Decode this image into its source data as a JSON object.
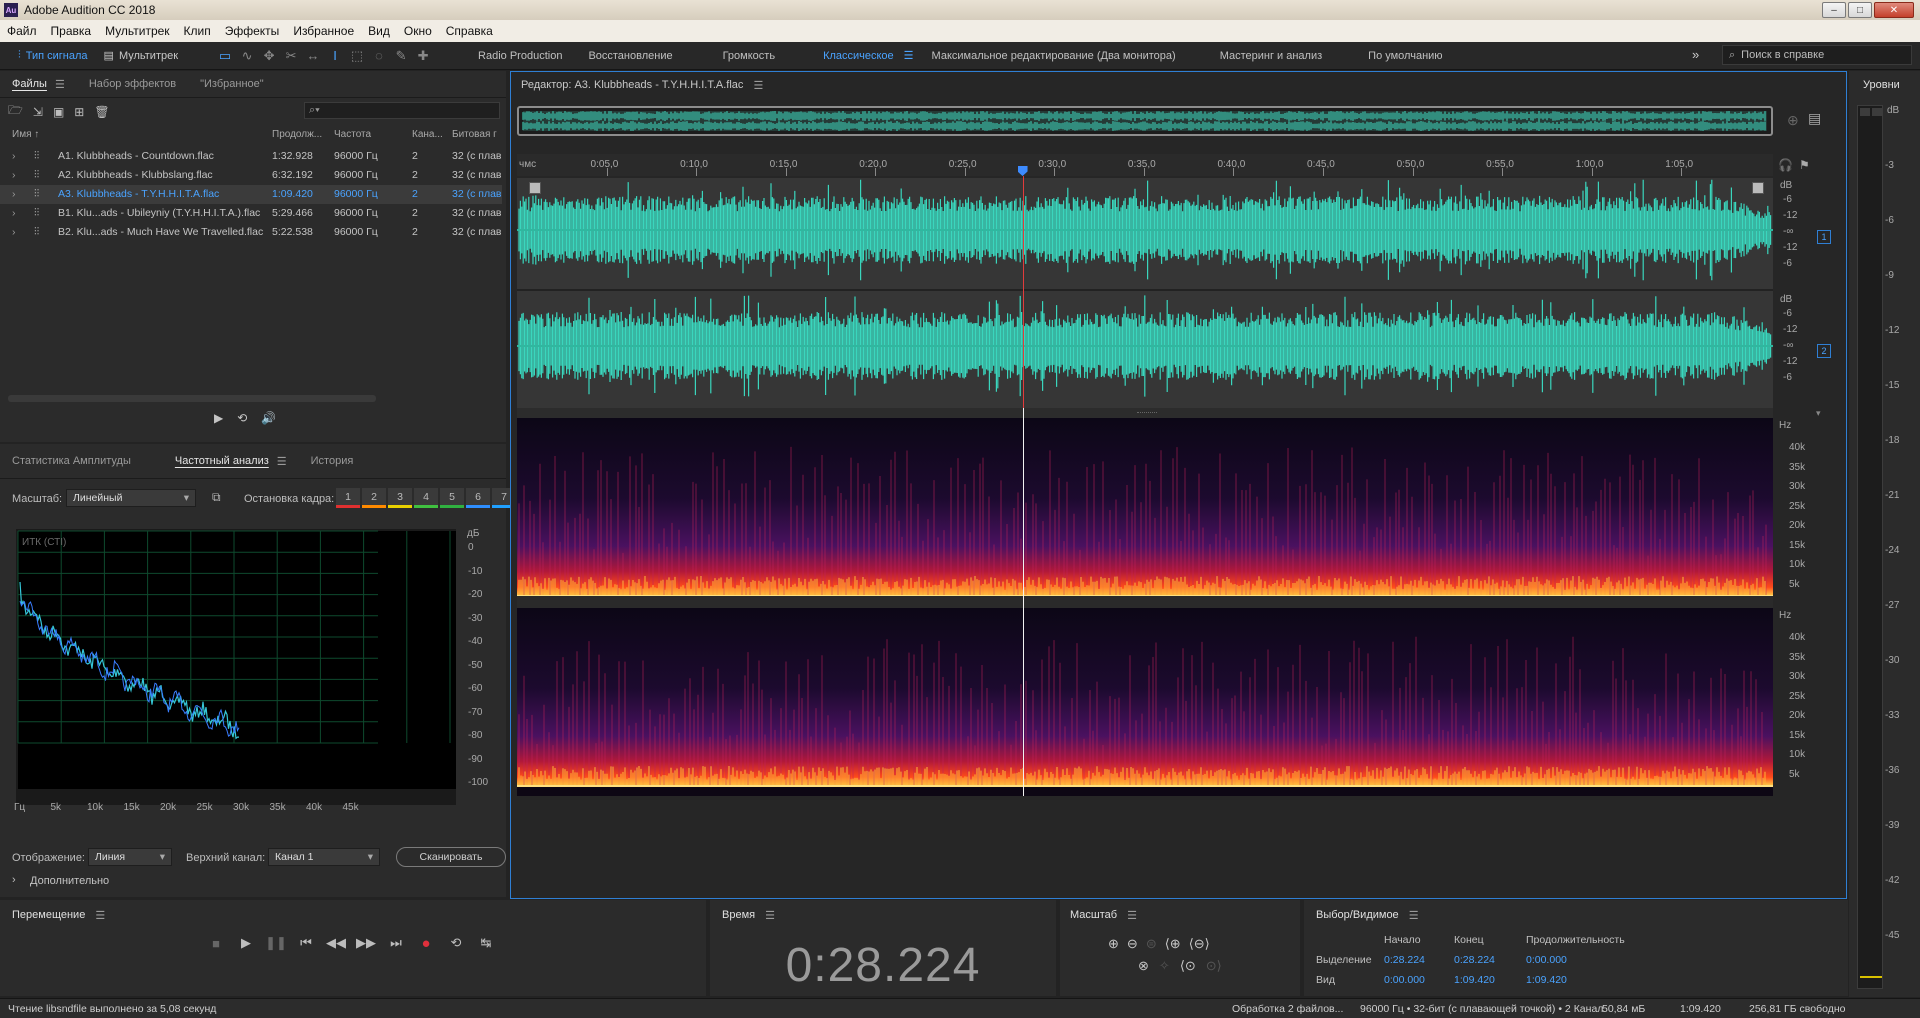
{
  "titlebar": {
    "app_title": "Adobe Audition CC 2018",
    "icon_text": "Au"
  },
  "menu": [
    "Файл",
    "Правка",
    "Мультитрек",
    "Клип",
    "Эффекты",
    "Избранное",
    "Вид",
    "Окно",
    "Справка"
  ],
  "toolbar": {
    "waveform_label": "Тип сигнала",
    "multitrack_label": "Мультитрек",
    "workspaces": [
      "Radio Production",
      "Восстановление",
      "Громкость",
      "Классическое",
      "Максимальное редактирование (Два монитора)",
      "Мастеринг и анализ",
      "По умолчанию"
    ],
    "active_workspace": "Классическое",
    "search_placeholder": "Поиск в справке"
  },
  "files_panel": {
    "tabs": [
      "Файлы",
      "Набор эффектов",
      "\"Избранное\""
    ],
    "search_placeholder": "",
    "columns": [
      "Имя",
      "Продолж...",
      "Частота",
      "Кана...",
      "Битовая г"
    ],
    "rows": [
      {
        "name": "A1. Klubbheads - Countdown.flac",
        "duration": "1:32.928",
        "rate": "96000 Гц",
        "ch": "2",
        "bits": "32 (с плав"
      },
      {
        "name": "A2. Klubbheads - Klubbslang.flac",
        "duration": "6:32.192",
        "rate": "96000 Гц",
        "ch": "2",
        "bits": "32 (с плав"
      },
      {
        "name": "A3. Klubbheads - T.Y.H.H.I.T.A.flac",
        "duration": "1:09.420",
        "rate": "96000 Гц",
        "ch": "2",
        "bits": "32 (с плав"
      },
      {
        "name": "B1. Klu...ads - Ubileyniy (T.Y.H.H.I.T.A.).flac",
        "duration": "5:29.466",
        "rate": "96000 Гц",
        "ch": "2",
        "bits": "32 (с плав"
      },
      {
        "name": "B2. Klu...ads - Much Have We Travelled.flac",
        "duration": "5:22.538",
        "rate": "96000 Гц",
        "ch": "2",
        "bits": "32 (с плав"
      }
    ],
    "selected_index": 2
  },
  "analysis_panel": {
    "tabs": [
      "Статистика Амплитуды",
      "Частотный анализ",
      "История"
    ],
    "scale_label": "Масштаб:",
    "scale_value": "Линейный",
    "freeze_label": "Остановка кадра:",
    "freeze_slots": [
      "1",
      "2",
      "3",
      "4",
      "5",
      "6",
      "7"
    ],
    "freeze_colors": [
      "#e03030",
      "#ff8a00",
      "#e8d000",
      "#40c040",
      "#30b040",
      "#2f8fff",
      "#20a0ff"
    ],
    "graph_title": "ИТК (СТІ)",
    "db_unit": "дБ",
    "db_ticks": [
      "0",
      "-10",
      "-20",
      "-30",
      "-40",
      "-50",
      "-60",
      "-70",
      "-80",
      "-90",
      "-100"
    ],
    "hz_ticks": [
      "Гц",
      "5k",
      "10k",
      "15k",
      "20k",
      "25k",
      "30k",
      "35k",
      "40k",
      "45k"
    ],
    "display_label": "Отображение:",
    "display_value": "Линия",
    "channel_label": "Верхний канал:",
    "channel_value": "Канал 1",
    "scan_button": "Сканировать",
    "advanced_label": "Дополнительно"
  },
  "editor": {
    "title": "Редактор: A3. Klubbheads - T.Y.H.H.I.T.A.flac",
    "time_unit": "чмс",
    "ruler": [
      "0:05,0",
      "0:10,0",
      "0:15,0",
      "0:20,0",
      "0:25,0",
      "0:30,0",
      "0:35,0",
      "0:40,0",
      "0:45,0",
      "0:50,0",
      "0:55,0",
      "1:00,0",
      "1:05,0"
    ],
    "db_label": "dB",
    "db_scale": [
      "-6",
      "-12",
      "-∞",
      "-12",
      "-6"
    ],
    "channel_badges": [
      "1",
      "2"
    ],
    "hz_label": "Hz",
    "hz_scale": [
      "40k",
      "35k",
      "30k",
      "25k",
      "20k",
      "15k",
      "10k",
      "5k"
    ],
    "playhead_time_sec": 28.224,
    "total_sec": 69.42
  },
  "levels": {
    "title": "Уровни",
    "ticks": [
      "dB",
      "-3",
      "-6",
      "-9",
      "-12",
      "-15",
      "-18",
      "-21",
      "-24",
      "-27",
      "-30",
      "-33",
      "-36",
      "-39",
      "-42",
      "-45"
    ]
  },
  "transport": {
    "title": "Перемещение"
  },
  "time_panel": {
    "title": "Время",
    "value": "0:28.224"
  },
  "zoom_panel": {
    "title": "Масштаб"
  },
  "selection_panel": {
    "title": "Выбор/Видимое",
    "col_start": "Начало",
    "col_end": "Конец",
    "col_duration": "Продолжительность",
    "row_selection": "Выделение",
    "row_view": "Вид",
    "sel_start": "0:28.224",
    "sel_end": "0:28.224",
    "sel_duration": "0:00.000",
    "view_start": "0:00.000",
    "view_end": "1:09.420",
    "view_duration": "1:09.420"
  },
  "status": {
    "left": "Чтение libsndfile выполнено за 5,08 секунд",
    "processing": "Обработка 2 файлов...",
    "format": "96000 Гц • 32-бит (с плавающей точкой) • 2 Канал",
    "size": "50,84 мБ",
    "duration": "1:09.420",
    "free": "256,81 ГБ свободно"
  }
}
